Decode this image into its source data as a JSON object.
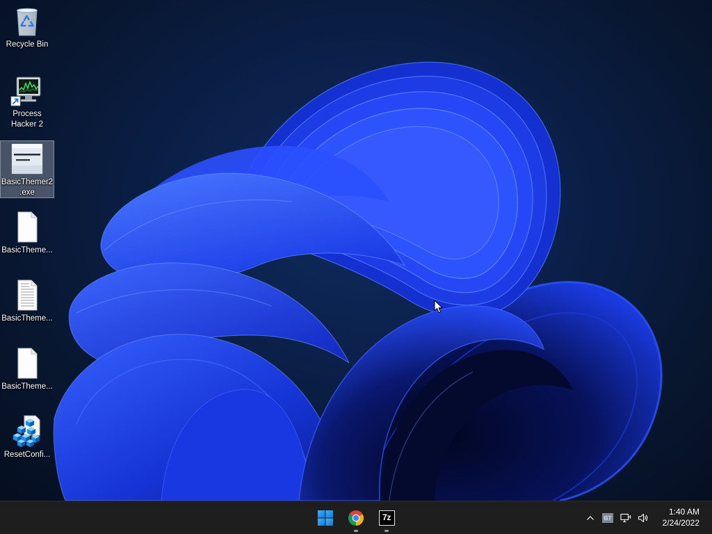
{
  "desktop": {
    "icons": [
      {
        "label": "Recycle Bin",
        "icon": "recycle-bin-icon",
        "selected": false
      },
      {
        "label": "Process Hacker 2",
        "icon": "process-hacker-icon",
        "shortcut": true,
        "selected": false
      },
      {
        "label": "BasicThemer2.exe",
        "icon": "application-window-icon",
        "selected": true
      },
      {
        "label": "BasicTheme...",
        "icon": "blank-file-icon",
        "selected": false
      },
      {
        "label": "BasicTheme...",
        "icon": "text-file-icon",
        "selected": false
      },
      {
        "label": "BasicTheme...",
        "icon": "blank-file-icon",
        "selected": false
      },
      {
        "label": "ResetConfi...",
        "icon": "registry-file-icon",
        "selected": false
      }
    ]
  },
  "taskbar": {
    "apps": [
      {
        "icon": "windows-start-icon",
        "running": false
      },
      {
        "icon": "chrome-icon",
        "running": true
      },
      {
        "icon": "seven-zip-icon",
        "label": "7z",
        "running": true
      }
    ],
    "tray": {
      "overflow_icon": "chevron-up-icon",
      "badge_icon": "bt-tray-icon",
      "badge_label": "BT",
      "network_icon": "network-icon",
      "volume_icon": "volume-icon",
      "time": "1:40 AM",
      "date": "2/24/2022"
    }
  },
  "cursor": {
    "icon": "arrow-cursor-icon"
  },
  "colors": {
    "wallpaper_base": "#0b2049",
    "bloom_blue": "#1f43f2",
    "taskbar_bg": "#1e1e1e",
    "selection_bg": "#7d8796",
    "start_blue": "#0a84f0"
  }
}
